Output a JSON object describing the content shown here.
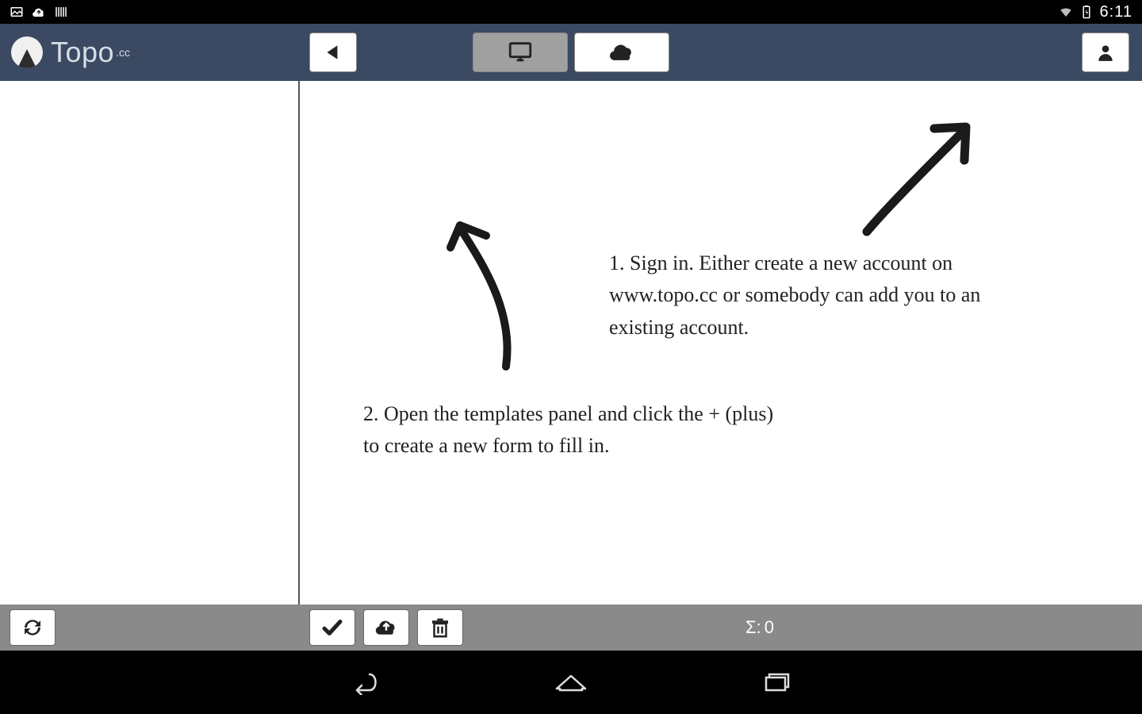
{
  "status_bar": {
    "time": "6:11"
  },
  "header": {
    "app_name": "Topo",
    "app_suffix": ".cc"
  },
  "tips": {
    "step1": "1. Sign in. Either create a new account on www.topo.cc or somebody can add you to an existing account.",
    "step2": "2. Open the templates panel and click the + (plus) to create a new form to fill in."
  },
  "footer": {
    "sigma_label": "Σ:",
    "sigma_value": "0"
  }
}
